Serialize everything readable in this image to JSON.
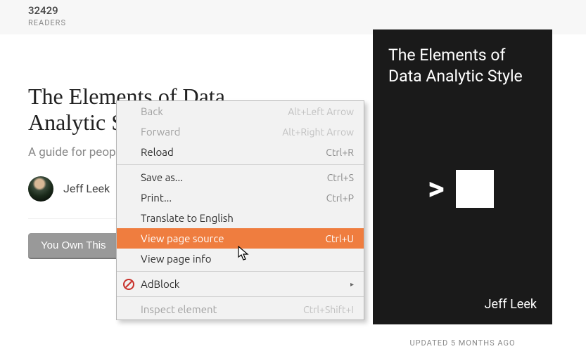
{
  "topbar": {
    "readers_count": "32429",
    "readers_label": "READERS"
  },
  "page": {
    "title": "The Elements of Data Analytic Style",
    "subtitle": "A guide for peop",
    "author": "Jeff Leek",
    "own_button": "You Own This"
  },
  "book": {
    "title_line1": "The Elements of",
    "title_line2": "Data Analytic Style",
    "author": "Jeff Leek",
    "updated": "UPDATED 5 MONTHS AGO"
  },
  "context_menu": {
    "back": {
      "label": "Back",
      "shortcut": "Alt+Left Arrow"
    },
    "forward": {
      "label": "Forward",
      "shortcut": "Alt+Right Arrow"
    },
    "reload": {
      "label": "Reload",
      "shortcut": "Ctrl+R"
    },
    "save_as": {
      "label": "Save as...",
      "shortcut": "Ctrl+S"
    },
    "print": {
      "label": "Print...",
      "shortcut": "Ctrl+P"
    },
    "translate": {
      "label": "Translate to English"
    },
    "view_source": {
      "label": "View page source",
      "shortcut": "Ctrl+U"
    },
    "view_info": {
      "label": "View page info"
    },
    "adblock": {
      "label": "AdBlock"
    },
    "inspect": {
      "label": "Inspect element",
      "shortcut": "Ctrl+Shift+I"
    }
  }
}
